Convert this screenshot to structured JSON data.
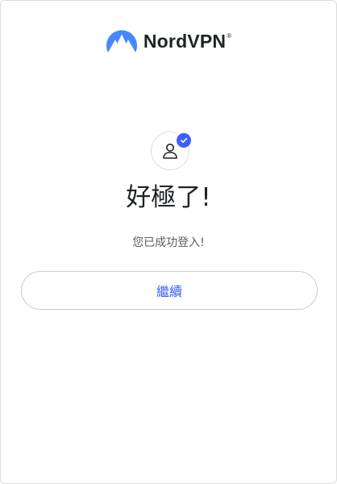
{
  "brand": {
    "name": "NordVPN",
    "registered_mark": "®",
    "logo_icon": "nordvpn-mountain-logo",
    "logo_color": "#4687ff"
  },
  "status": {
    "avatar_icon": "user-icon",
    "badge_icon": "checkmark-icon",
    "badge_color": "#3e5fff"
  },
  "headline": "好極了!",
  "message": "您已成功登入!",
  "continue_button": {
    "label": "繼續",
    "color": "#3e5fff"
  }
}
